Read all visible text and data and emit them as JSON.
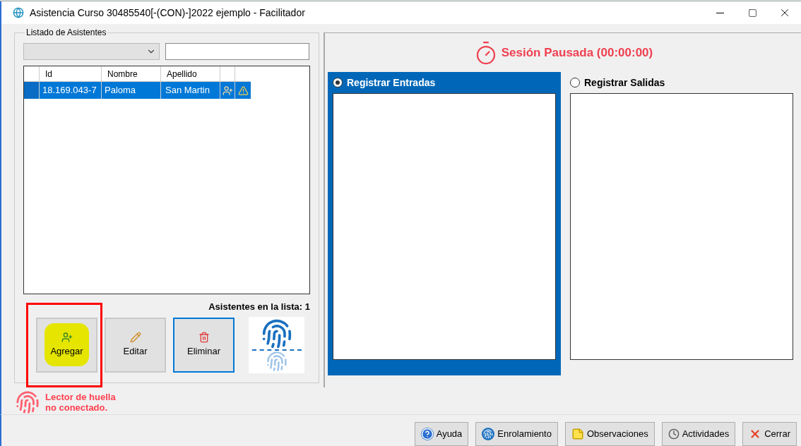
{
  "window": {
    "title": "Asistencia Curso 30485540[-(CON)-]2022 ejemplo - Facilitador"
  },
  "attendees": {
    "legend": "Listado de Asistentes",
    "columns": [
      "Id",
      "Nombre",
      "Apellido"
    ],
    "rows": [
      {
        "id": "18.169.043-7",
        "nombre": "Paloma",
        "apellido": "San Martin",
        "selected": true
      }
    ],
    "count_label": "Asistentes en la lista: 1"
  },
  "actions": [
    {
      "kind": "add",
      "label": "Agregar",
      "highlighted": true,
      "focused": false
    },
    {
      "kind": "edit",
      "label": "Editar",
      "highlighted": false,
      "focused": false
    },
    {
      "kind": "delete",
      "label": "Eliminar",
      "highlighted": false,
      "focused": true
    }
  ],
  "reader_status": [
    "Lector de huella",
    "no conectado."
  ],
  "session_status": "Sesión Pausada (00:00:00)",
  "modes": [
    {
      "label": "Registrar Entradas",
      "selected": true
    },
    {
      "label": "Registrar Salidas",
      "selected": false
    }
  ],
  "footer_buttons": [
    {
      "kind": "help",
      "label": "Ayuda"
    },
    {
      "kind": "enroll",
      "label": "Enrolamiento"
    },
    {
      "kind": "notes",
      "label": "Observaciones"
    },
    {
      "kind": "activities",
      "label": "Actividades"
    },
    {
      "kind": "close",
      "label": "Cerrar"
    }
  ]
}
